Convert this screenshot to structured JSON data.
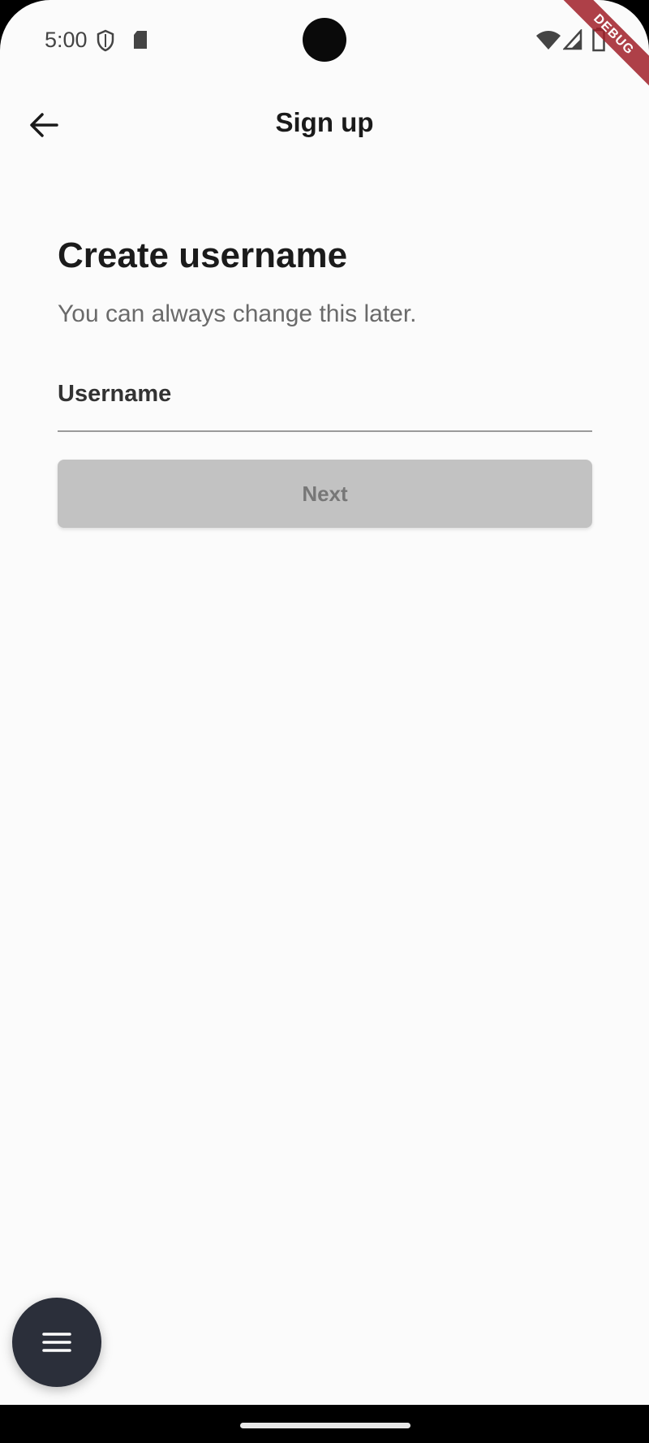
{
  "status_bar": {
    "time": "5:00",
    "icons": [
      "shield-icon",
      "sd-card-icon",
      "wifi-icon",
      "signal-icon",
      "battery-icon"
    ]
  },
  "debug_banner": {
    "label": "DEBUG"
  },
  "app_bar": {
    "title": "Sign up",
    "back_icon": "arrow-left-icon"
  },
  "main": {
    "title": "Create username",
    "subtitle": "You can always change this later.",
    "username_field": {
      "label": "Username",
      "value": ""
    },
    "next_button": {
      "label": "Next",
      "enabled": false
    }
  },
  "fab": {
    "icon": "menu-icon"
  },
  "colors": {
    "background": "#fbfbfb",
    "button_disabled": "#c2c2c2",
    "fab": "#2b2f3a",
    "debug_banner": "#a01e28"
  }
}
